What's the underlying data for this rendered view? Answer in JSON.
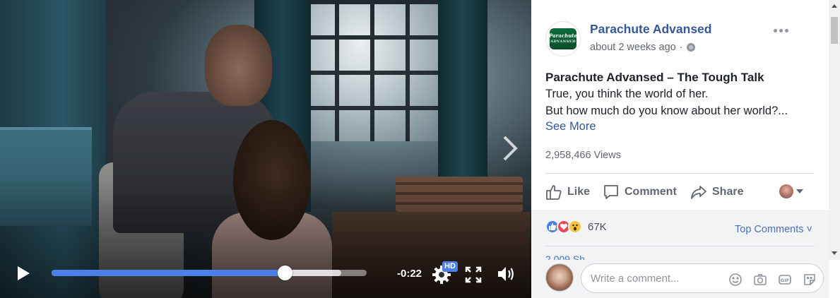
{
  "video": {
    "time_remaining": "-0:22",
    "progress": 0.74,
    "buffered": 0.92,
    "hd_label": "HD"
  },
  "post": {
    "page_name": "Parachute Advansed",
    "timestamp": "about 2 weeks ago",
    "separator": "·",
    "title": "Parachute Advansed – The Tough Talk",
    "line1": "True, you think the world of her.",
    "line2": "But how much do you know about her world?...",
    "see_more": "See More",
    "views": "2,958,466 Views",
    "logo_text": "Parachute",
    "logo_sub": "ADVANSED"
  },
  "actions": {
    "like": "Like",
    "comment": "Comment",
    "share": "Share"
  },
  "reactions": {
    "count": "67K",
    "top_comments": "Top Comments",
    "top_comments_caret": "˅",
    "cut_text": "2,009 Sh"
  },
  "comment_box": {
    "placeholder": "Write a comment..."
  },
  "colors": {
    "brand_blue": "#365899",
    "progress_blue": "#4a80e8",
    "panel_bg": "#f2f3f5"
  }
}
